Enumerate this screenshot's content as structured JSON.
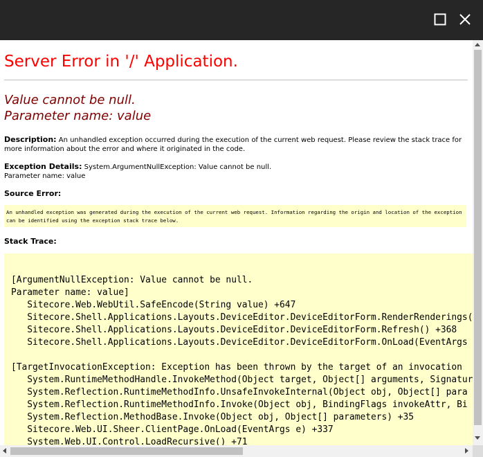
{
  "window": {
    "maximize_icon": "maximize-icon",
    "close_icon": "close-icon",
    "titlebar_color": "#262626"
  },
  "page": {
    "title": "Server Error in '/' Application.",
    "error_line1": "Value cannot be null.",
    "error_line2": "Parameter name: value",
    "description_label": "Description:",
    "description_text": " An unhandled exception occurred during the execution of the current web request. Please review the stack trace for more information about the error and where it originated in the code.",
    "exception_label": "Exception Details:",
    "exception_text1": " System.ArgumentNullException: Value cannot be null.",
    "exception_text2": "Parameter name: value",
    "source_error_label": "Source Error:",
    "source_error_text": "An unhandled exception was generated during the execution of the current web request. Information regarding the origin and location of the exception can be identified using the exception stack trace below.",
    "stack_trace_label": "Stack Trace:",
    "stack_trace": "[ArgumentNullException: Value cannot be null.\nParameter name: value]\n   Sitecore.Web.WebUtil.SafeEncode(String value) +647\n   Sitecore.Shell.Applications.Layouts.DeviceEditor.DeviceEditorForm.RenderRenderings(\n   Sitecore.Shell.Applications.Layouts.DeviceEditor.DeviceEditorForm.Refresh() +368\n   Sitecore.Shell.Applications.Layouts.DeviceEditor.DeviceEditorForm.OnLoad(EventArgs\n\n[TargetInvocationException: Exception has been thrown by the target of an invocation\n   System.RuntimeMethodHandle.InvokeMethod(Object target, Object[] arguments, Signatur\n   System.Reflection.RuntimeMethodInfo.UnsafeInvokeInternal(Object obj, Object[] para\n   System.Reflection.RuntimeMethodInfo.Invoke(Object obj, BindingFlags invokeAttr, Bi\n   System.Reflection.MethodBase.Invoke(Object obj, Object[] parameters) +35\n   Sitecore.Web.UI.Sheer.ClientPage.OnLoad(EventArgs e) +337\n   System.Web.UI.Control.LoadRecursive() +71",
    "colors": {
      "title": "#ff0000",
      "error": "#800000",
      "code_background": "#ffffcc"
    }
  }
}
